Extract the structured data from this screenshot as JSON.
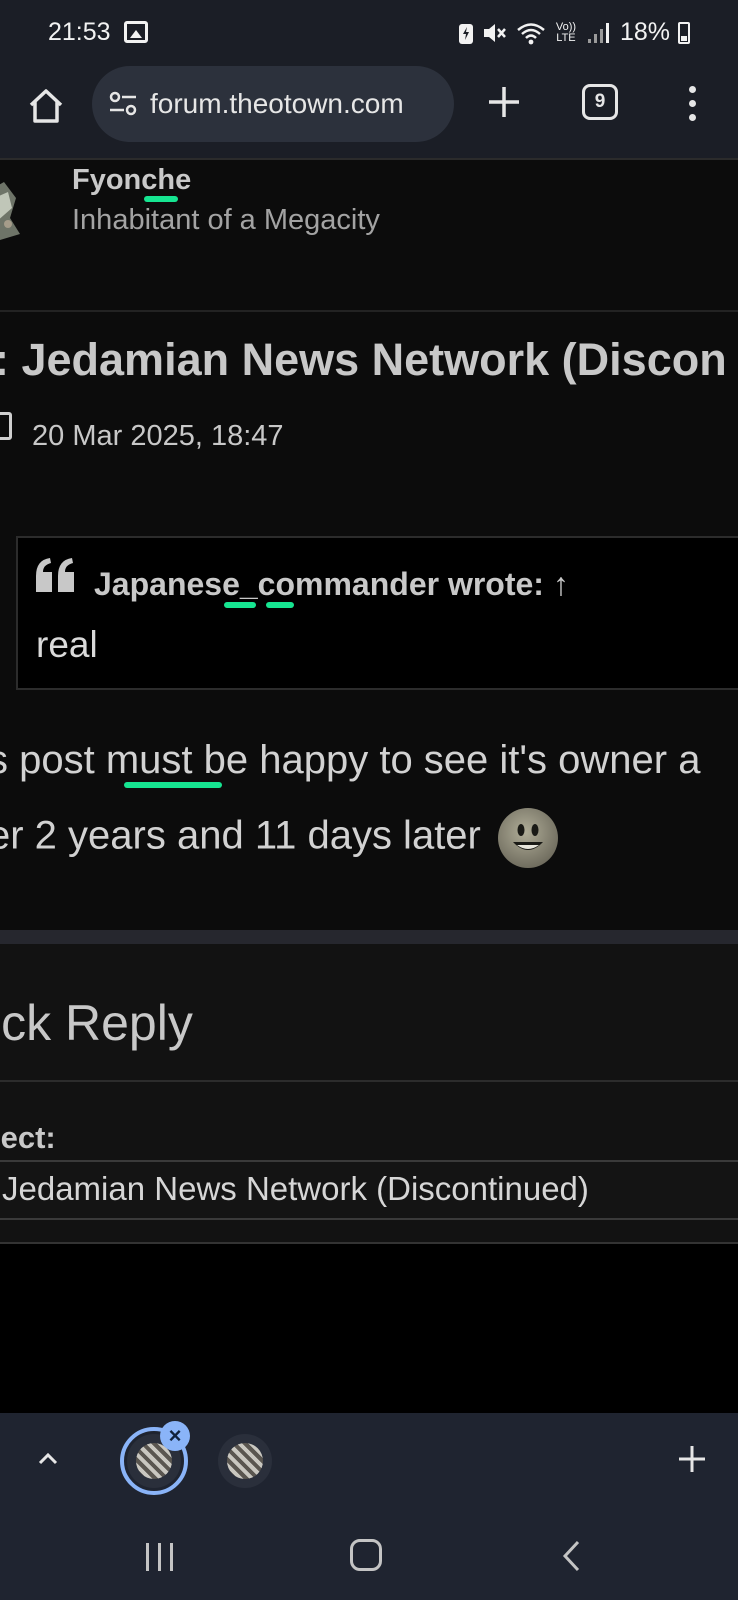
{
  "status_bar": {
    "time": "21:53",
    "battery": "18%",
    "icons": [
      "gallery-icon",
      "battery-saver-icon",
      "mute-icon",
      "wifi-icon",
      "volte-icon",
      "signal-icon",
      "battery-icon"
    ],
    "volte_text": "Vo)) LTE"
  },
  "browser": {
    "url": "forum.theotown.com",
    "tab_count": "9",
    "icons": [
      "home-icon",
      "site-settings-icon",
      "new-tab-icon",
      "tab-switcher-icon",
      "more-menu-icon"
    ]
  },
  "post": {
    "author_name": "Fyonche",
    "author_rank": "Inhabitant of a Megacity",
    "title": ": Jedamian News Network (Discon",
    "date": "20 Mar 2025, 18:47",
    "quote": {
      "author": "Japanese_commander wrote:",
      "arrow": "↑",
      "text": "real"
    },
    "body_line_1": "s post must be happy to see it's owner a",
    "body_line_2": "er 2 years and 11 days later",
    "emoji": "smiley-icon"
  },
  "quick_reply": {
    "title": "ick Reply",
    "subject_label": "ject:",
    "subject_value": "Jedamian News Network (Discontinued)"
  },
  "tab_strip": {
    "close_symbol": "×",
    "icons": [
      "chevron-up-icon",
      "new-tab-plus-icon"
    ]
  },
  "navigation": {
    "icons": [
      "recents-icon",
      "home-nav-icon",
      "back-icon"
    ]
  },
  "colors": {
    "highlight": "#16e591",
    "accent": "#8ab4f8",
    "background": "#0c0c0c"
  }
}
